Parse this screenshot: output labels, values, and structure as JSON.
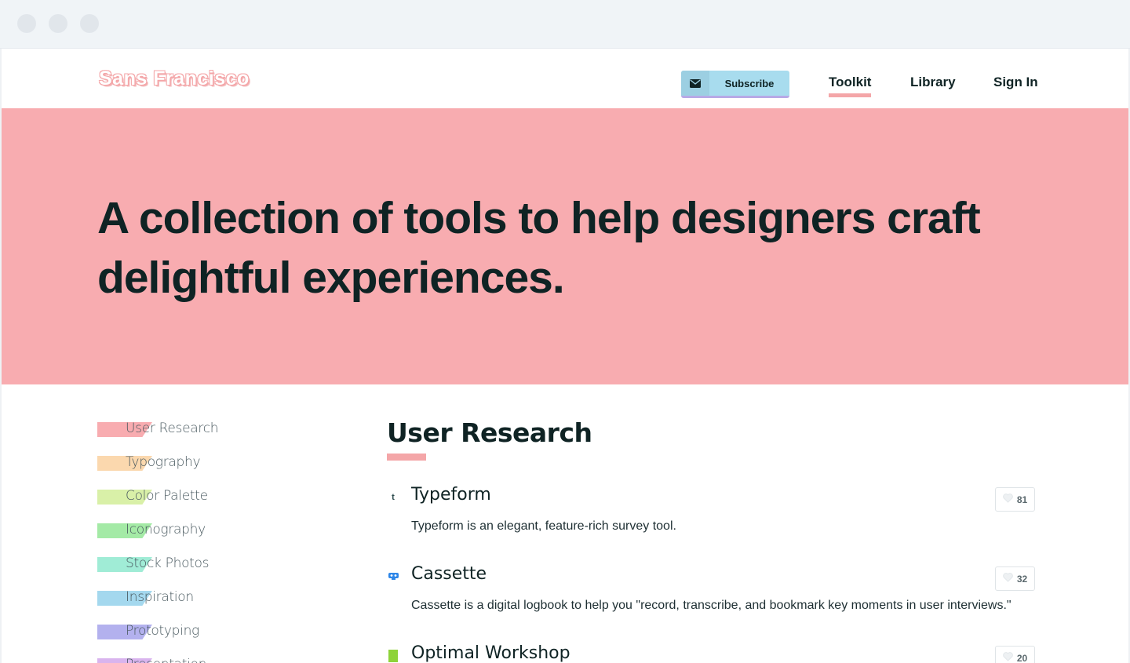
{
  "brand": {
    "logo": "Sans Francisco"
  },
  "header": {
    "subscribe_label": "Subscribe",
    "nav": [
      {
        "label": "Toolkit",
        "active": true
      },
      {
        "label": "Library"
      },
      {
        "label": "Sign In"
      }
    ]
  },
  "hero": {
    "title": "A collection of tools to help designers craft delightful experiences."
  },
  "sidebar": {
    "categories": [
      {
        "label": "User Research",
        "color": "#f8acb0"
      },
      {
        "label": "Typography",
        "color": "#fbd8ae"
      },
      {
        "label": "Color Palette",
        "color": "#d9f0a8"
      },
      {
        "label": "Iconography",
        "color": "#a4eaa6"
      },
      {
        "label": "Stock Photos",
        "color": "#a0ecd6"
      },
      {
        "label": "Inspiration",
        "color": "#a4d8ee"
      },
      {
        "label": "Prototyping",
        "color": "#b3b1ee"
      },
      {
        "label": "Presentation",
        "color": "#d9b4ee"
      }
    ]
  },
  "main": {
    "section_title": "User Research",
    "tools": [
      {
        "name": "Typeform",
        "description": "Typeform is an elegant, feature-rich survey tool.",
        "likes": "81",
        "icon": "typeform-logo-icon",
        "icon_glyph": "t",
        "icon_color": "#2b4a4c"
      },
      {
        "name": "Cassette",
        "description": "Cassette is a digital logbook to help you \"record, transcribe, and bookmark key moments in user interviews.\"",
        "likes": "32",
        "icon": "cassette-logo-icon",
        "icon_color": "#2d86e8"
      },
      {
        "name": "Optimal Workshop",
        "description": "",
        "likes": "20",
        "icon": "optimal-workshop-logo-icon",
        "icon_color": "#8ed33a"
      }
    ]
  },
  "colors": {
    "accent_pink": "#f8acb0",
    "subscribe_blue": "#a8dcee",
    "text_dark": "#0f2324"
  }
}
